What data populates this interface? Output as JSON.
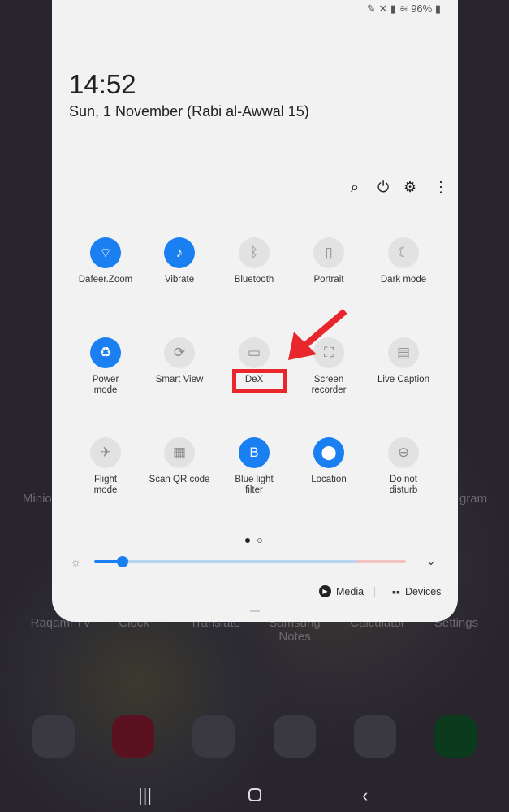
{
  "status": {
    "battery": "96%"
  },
  "clock": {
    "time": "14:52",
    "date": "Sun, 1 November (Rabi al-Awwal 15)"
  },
  "header_icons": [
    "search-icon",
    "power-icon",
    "gear-icon",
    "more-icon"
  ],
  "tiles": [
    {
      "label": "Dafeer.Zoom",
      "icon": "wifi-icon",
      "on": true
    },
    {
      "label": "Vibrate",
      "icon": "vibrate-icon",
      "on": true
    },
    {
      "label": "Bluetooth",
      "icon": "bluetooth-icon",
      "on": false
    },
    {
      "label": "Portrait",
      "icon": "portrait-lock-icon",
      "on": false
    },
    {
      "label": "Dark mode",
      "icon": "moon-icon",
      "on": false
    },
    {
      "label": "Power\nmode",
      "icon": "battery-icon",
      "on": true
    },
    {
      "label": "Smart View",
      "icon": "smart-view-icon",
      "on": false
    },
    {
      "label": "DeX",
      "icon": "dex-icon",
      "on": false
    },
    {
      "label": "Screen\nrecorder",
      "icon": "screen-record-icon",
      "on": false
    },
    {
      "label": "Live Caption",
      "icon": "caption-icon",
      "on": false
    },
    {
      "label": "Flight\nmode",
      "icon": "airplane-icon",
      "on": false
    },
    {
      "label": "Scan QR code",
      "icon": "qr-icon",
      "on": false
    },
    {
      "label": "Blue light\nfilter",
      "icon": "blue-light-icon",
      "on": true
    },
    {
      "label": "Location",
      "icon": "location-icon",
      "on": true
    },
    {
      "label": "Do not\ndisturb",
      "icon": "dnd-icon",
      "on": false
    }
  ],
  "brightness": {
    "level_percent": 9
  },
  "footer": {
    "media": "Media",
    "devices": "Devices"
  },
  "page_indicator": {
    "current": 1,
    "total": 2
  },
  "background_apps": [
    "Minion",
    "Raqami TV",
    "Clock",
    "Translate",
    "Samsung Notes",
    "Calculator",
    "Settings",
    "gram"
  ],
  "annotation_color": "#e8262c"
}
